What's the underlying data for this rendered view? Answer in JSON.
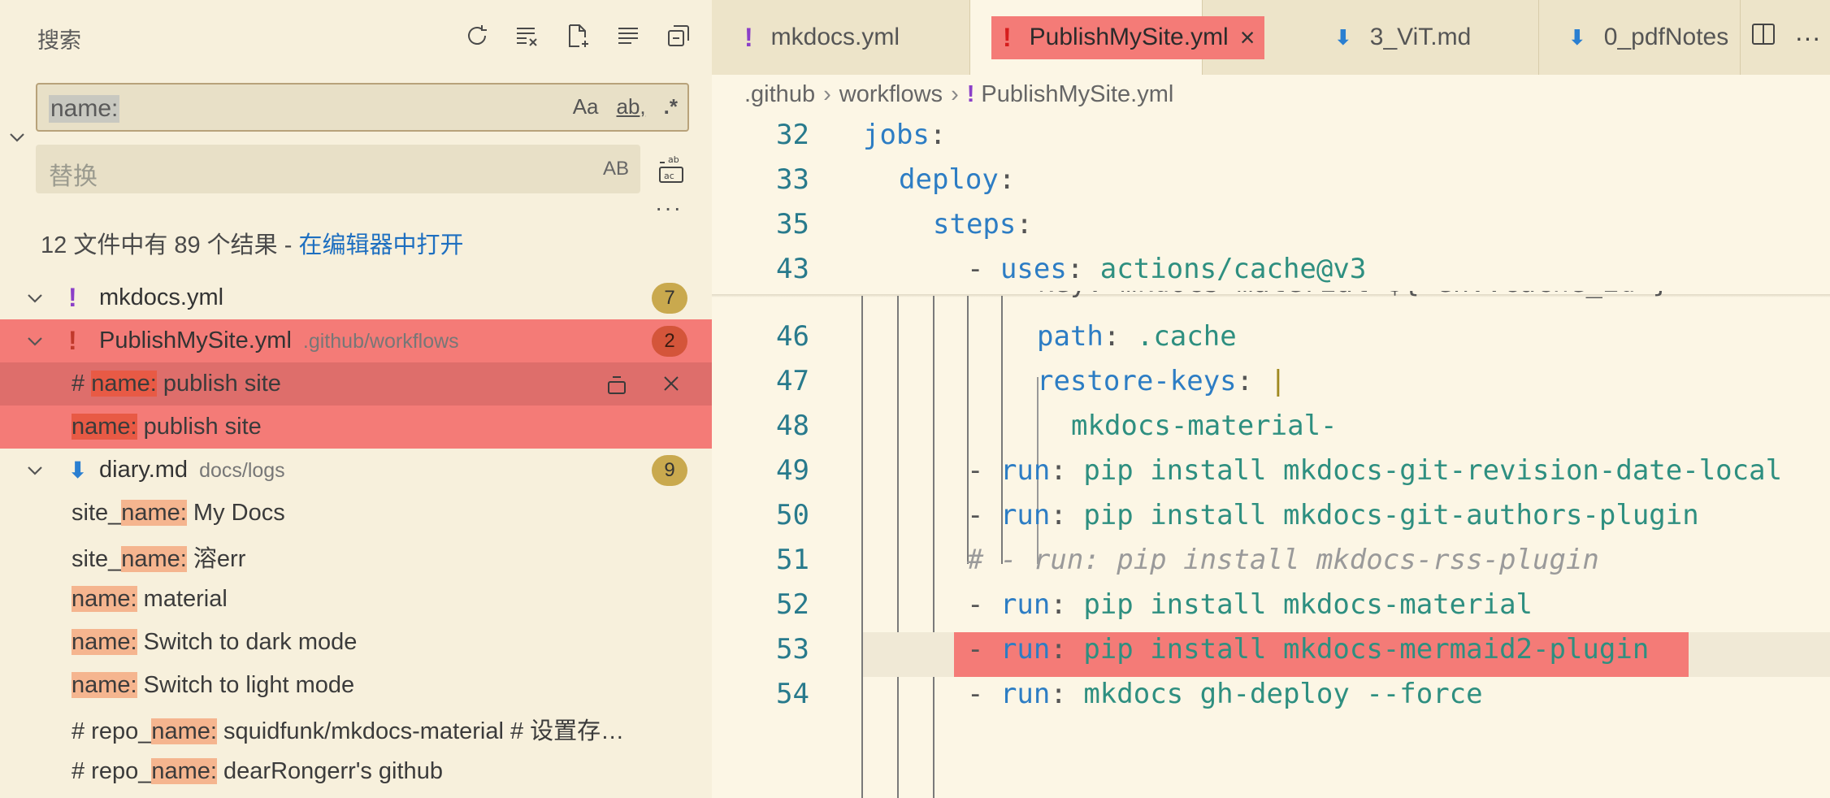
{
  "sidebar": {
    "title": "搜索",
    "actions": [
      "refresh-icon",
      "clear-results-icon",
      "new-search-editor-icon",
      "view-as-tree-icon",
      "collapse-all-icon"
    ],
    "search": {
      "value": "name:",
      "opt_case": "Aa",
      "opt_word": "ab",
      "opt_regex": ".*"
    },
    "replace": {
      "placeholder": "替换",
      "preserve_case": "AB"
    },
    "more": "···",
    "summary": {
      "text": "12 文件中有 89 个结果 - ",
      "link": "在编辑器中打开"
    },
    "files": [
      {
        "name": "mkdocs.yml",
        "path": "",
        "count": "7"
      },
      {
        "name": "PublishMySite.yml",
        "path": ".github/workflows",
        "count": "2"
      },
      {
        "name": "diary.md",
        "path": "docs/logs",
        "count": "9"
      }
    ],
    "matches_publish": [
      {
        "pre": "# ",
        "hit": "name:",
        "post": " publish site"
      },
      {
        "pre": "",
        "hit": "name:",
        "post": " publish site"
      }
    ],
    "matches_diary": [
      {
        "pre": "site_",
        "hit": "name:",
        "post": " My Docs"
      },
      {
        "pre": "site_",
        "hit": "name:",
        "post": " 溶err"
      },
      {
        "pre": "",
        "hit": "name:",
        "post": " material"
      },
      {
        "pre": "",
        "hit": "name:",
        "post": " Switch to dark mode"
      },
      {
        "pre": "",
        "hit": "name:",
        "post": " Switch to light mode"
      },
      {
        "pre": "# repo_",
        "hit": "name:",
        "post": " squidfunk/mkdocs-material # 设置存…"
      },
      {
        "pre": "# repo_",
        "hit": "name:",
        "post": " dearRongerr's github"
      }
    ]
  },
  "editor": {
    "tabs": [
      {
        "name": "mkdocs.yml",
        "icon": "!"
      },
      {
        "name": "PublishMySite.yml",
        "icon": "!"
      },
      {
        "name": "3_ViT.md",
        "icon": "md"
      },
      {
        "name": "0_pdfNotes",
        "icon": "md"
      }
    ],
    "breadcrumb": [
      ".github",
      "workflows",
      "PublishMySite.yml"
    ],
    "sticky_lines": [
      {
        "num": "32",
        "key": "jobs",
        "val": ""
      },
      {
        "num": "33",
        "key": "deploy",
        "val": ""
      },
      {
        "num": "35",
        "key": "steps",
        "val": ""
      },
      {
        "num": "43",
        "dash": "- ",
        "key": "uses",
        "val": "actions/cache@v3"
      }
    ],
    "partial_line": "key: mkdocs-material-${ env.cache_id }",
    "lines": [
      {
        "num": "46",
        "key": "path",
        "val": ".cache"
      },
      {
        "num": "47",
        "key": "restore-keys",
        "val": "|"
      },
      {
        "num": "48",
        "val": "mkdocs-material-"
      },
      {
        "num": "49",
        "dash": "- ",
        "key": "run",
        "val": "pip install mkdocs-git-revision-date-local"
      },
      {
        "num": "50",
        "dash": "- ",
        "key": "run",
        "val": "pip install mkdocs-git-authors-plugin"
      },
      {
        "num": "51",
        "comment": "# - run: pip install mkdocs-rss-plugin"
      },
      {
        "num": "52",
        "dash": "- ",
        "key": "run",
        "val": "pip install mkdocs-material"
      },
      {
        "num": "53",
        "dash": "- ",
        "key": "run",
        "val": "pip install mkdocs-mermaid2-plugin"
      },
      {
        "num": "54",
        "dash": "- ",
        "key": "run",
        "val": "mkdocs gh-deploy --force"
      }
    ]
  }
}
